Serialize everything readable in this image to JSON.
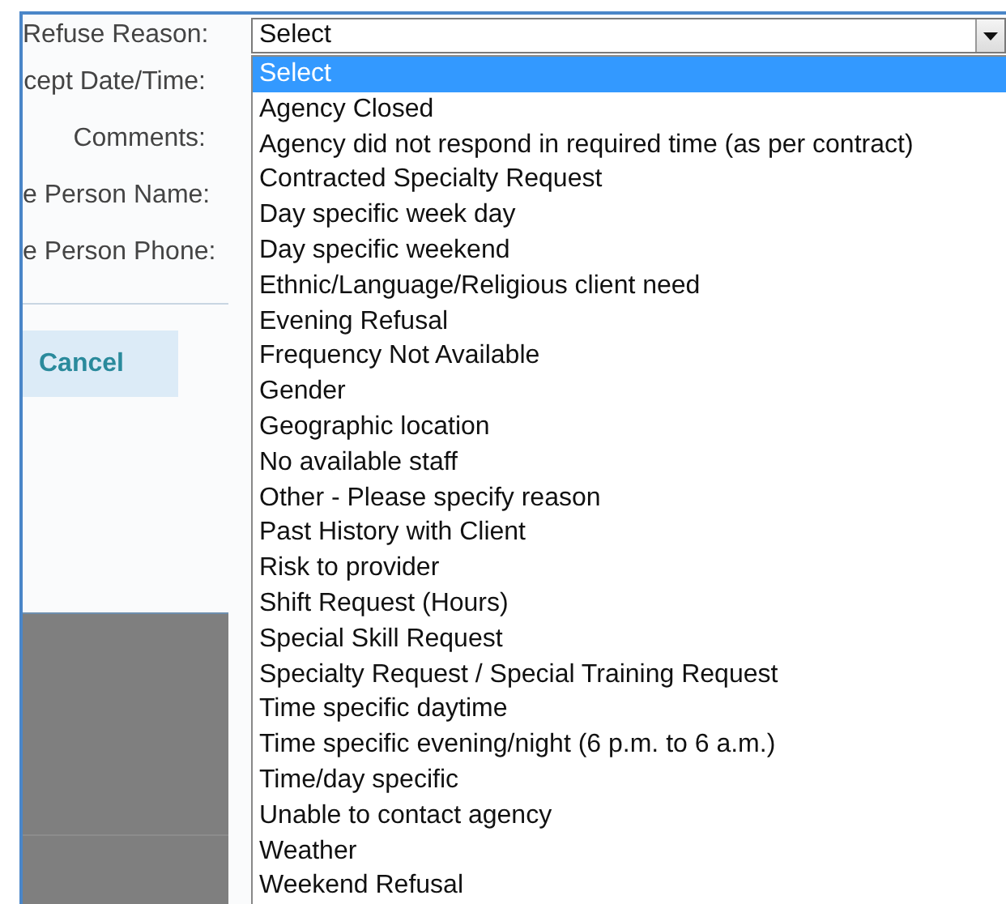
{
  "form": {
    "labels": [
      "Refuse Reason:",
      "cept Date/Time:",
      "Comments:",
      "e Person Name:",
      "e Person Phone:"
    ],
    "cancel_button": "Cancel"
  },
  "refuse_reason_select": {
    "value": "Select",
    "options": [
      {
        "label": "Select",
        "selected": true
      },
      {
        "label": "Agency Closed",
        "selected": false
      },
      {
        "label": "Agency did not respond in required time (as per contract)",
        "selected": false
      },
      {
        "label": "Contracted Specialty Request",
        "selected": false
      },
      {
        "label": "Day specific week day",
        "selected": false
      },
      {
        "label": "Day specific weekend",
        "selected": false
      },
      {
        "label": "Ethnic/Language/Religious client need",
        "selected": false
      },
      {
        "label": "Evening Refusal",
        "selected": false
      },
      {
        "label": "Frequency Not Available",
        "selected": false
      },
      {
        "label": "Gender",
        "selected": false
      },
      {
        "label": "Geographic location",
        "selected": false
      },
      {
        "label": "No available staff",
        "selected": false
      },
      {
        "label": "Other - Please specify reason",
        "selected": false
      },
      {
        "label": "Past History with Client",
        "selected": false
      },
      {
        "label": "Risk to provider",
        "selected": false
      },
      {
        "label": "Shift Request (Hours)",
        "selected": false
      },
      {
        "label": "Special Skill Request",
        "selected": false
      },
      {
        "label": "Specialty Request / Special Training Request",
        "selected": false
      },
      {
        "label": "Time specific daytime",
        "selected": false
      },
      {
        "label": "Time specific evening/night (6 p.m. to 6 a.m.)",
        "selected": false
      },
      {
        "label": "Time/day specific",
        "selected": false
      },
      {
        "label": "Unable to contact agency",
        "selected": false
      },
      {
        "label": "Weather",
        "selected": false
      },
      {
        "label": "Weekend Refusal",
        "selected": false
      }
    ]
  }
}
